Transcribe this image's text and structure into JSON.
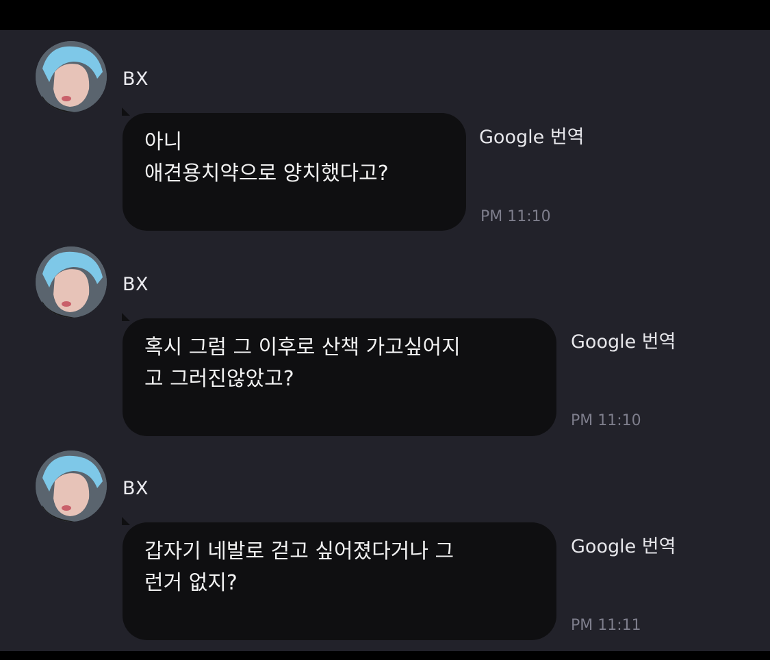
{
  "messages": [
    {
      "sender": "BX",
      "lines": [
        "아니",
        "애견용치약으로 양치했다고?"
      ],
      "translate_label": "Google 번역",
      "time": "PM 11:10"
    },
    {
      "sender": "BX",
      "lines": [
        "혹시 그럼 그 이후로 산책 가고싶어지",
        "고 그러진않았고?"
      ],
      "translate_label": "Google 번역",
      "time": "PM 11:10"
    },
    {
      "sender": "BX",
      "lines": [
        "갑자기 네발로 걷고 싶어졌다거나 그",
        "런거 없지?"
      ],
      "translate_label": "Google 번역",
      "time": "PM 11:11"
    }
  ]
}
